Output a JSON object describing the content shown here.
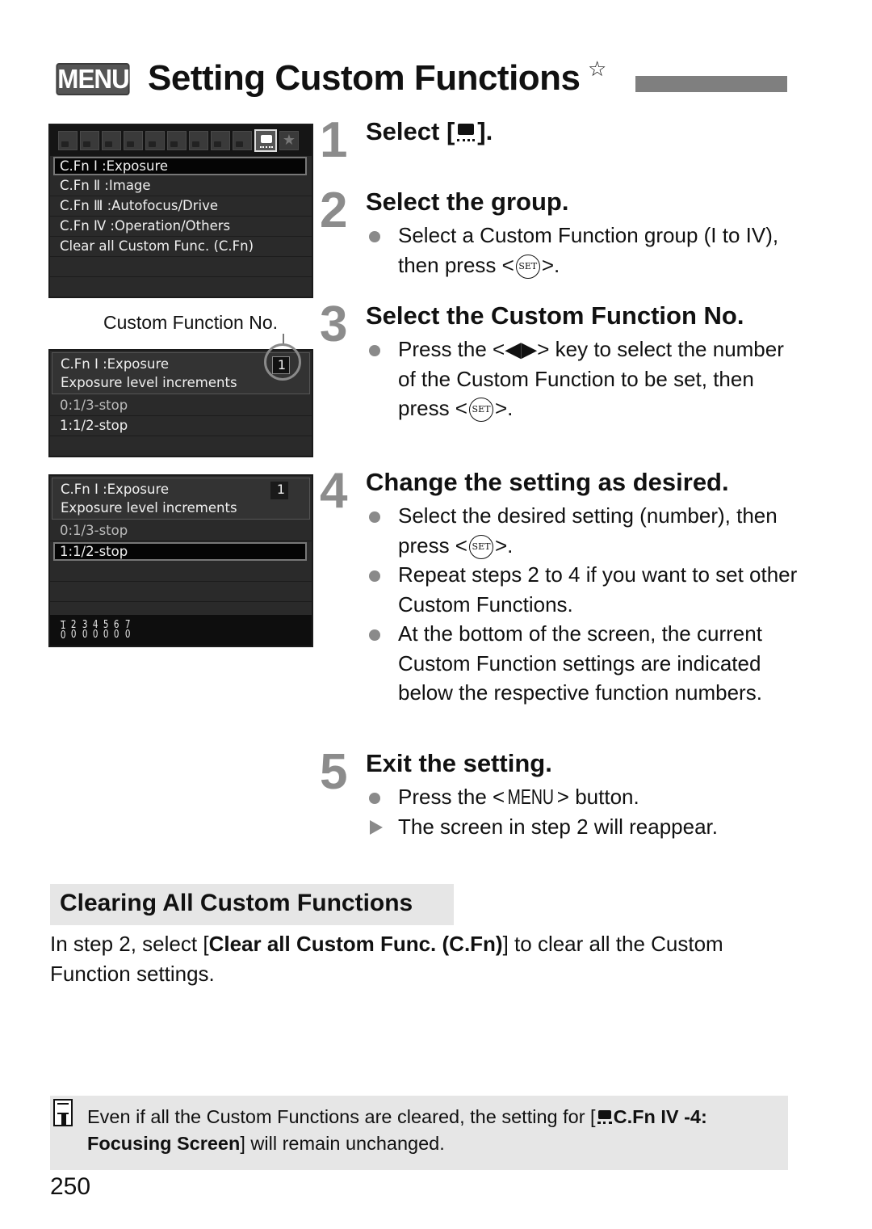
{
  "header": {
    "menu_badge": "MENU",
    "title": "Setting Custom Functions",
    "star": "☆"
  },
  "lcd_screen_1": {
    "tabs": [
      "shooting-1",
      "shooting-2",
      "shooting-3",
      "shooting-4",
      "playback-1",
      "playback-2",
      "setup-1",
      "setup-2",
      "setup-3",
      "custom-functions",
      "my-menu"
    ],
    "active_tab": "custom-functions",
    "items": [
      {
        "label": "C.Fn Ⅰ :Exposure",
        "selected": true
      },
      {
        "label": "C.Fn Ⅱ :Image",
        "selected": false
      },
      {
        "label": "C.Fn Ⅲ :Autofocus/Drive",
        "selected": false
      },
      {
        "label": "C.Fn Ⅳ :Operation/Others",
        "selected": false
      },
      {
        "label": "Clear all Custom Func. (C.Fn)",
        "selected": false
      }
    ]
  },
  "callout": {
    "label": "Custom Function No."
  },
  "lcd_screen_2": {
    "group": "C.Fn Ⅰ :Exposure",
    "function_name": "Exposure level increments",
    "function_number": "1",
    "options": [
      {
        "label": "0:1/3-stop",
        "selected": false
      },
      {
        "label": "1:1/2-stop",
        "selected": false
      }
    ]
  },
  "lcd_screen_3": {
    "group": "C.Fn Ⅰ :Exposure",
    "function_name": "Exposure level increments",
    "function_number": "1",
    "options": [
      {
        "label": "0:1/3-stop",
        "selected": false
      },
      {
        "label": "1:1/2-stop",
        "selected": true
      }
    ],
    "function_numbers": [
      "1",
      "2",
      "3",
      "4",
      "5",
      "6",
      "7"
    ],
    "function_settings": [
      "0",
      "0",
      "0",
      "0",
      "0",
      "0",
      "0"
    ]
  },
  "steps": [
    {
      "number": "1",
      "title_before": "Select [",
      "title_after": "].",
      "bullets": []
    },
    {
      "number": "2",
      "title": "Select the group.",
      "bullets": [
        {
          "type": "dot",
          "before": "Select a Custom Function group (I to IV), then press <",
          "after": ">."
        }
      ]
    },
    {
      "number": "3",
      "title": "Select the Custom Function No.",
      "bullets": [
        {
          "type": "dot",
          "before": "Press the <◀▶> key to select the number of the Custom Function to be set, then press <",
          "after": ">."
        }
      ]
    },
    {
      "number": "4",
      "title": "Change the setting as desired.",
      "bullets": [
        {
          "type": "dot",
          "before": "Select the desired setting (number), then press <",
          "after": ">."
        },
        {
          "type": "dot",
          "text": "Repeat steps 2 to 4 if you want to set other Custom Functions."
        },
        {
          "type": "dot",
          "text": "At the bottom of the screen, the current Custom Function settings are indicated below the respective function numbers."
        }
      ]
    },
    {
      "number": "5",
      "title": "Exit the setting.",
      "bullets": [
        {
          "type": "dot",
          "before": "Press the <",
          "menu": "MENU",
          "after": "> button."
        },
        {
          "type": "arrow",
          "text": "The screen in step 2 will reappear."
        }
      ]
    }
  ],
  "set_button_label": "SET",
  "clearing": {
    "heading": "Clearing All Custom Functions",
    "body_before": "In step 2, select [",
    "body_bold": "Clear all Custom Func. (C.Fn)",
    "body_after": "] to clear all the Custom Function settings."
  },
  "note": {
    "text_before": "Even if all the Custom Functions are cleared, the setting for [",
    "bold_1": "C.Fn IV -4: Focusing Screen",
    "text_after": "] will remain unchanged."
  },
  "page_number": "250"
}
